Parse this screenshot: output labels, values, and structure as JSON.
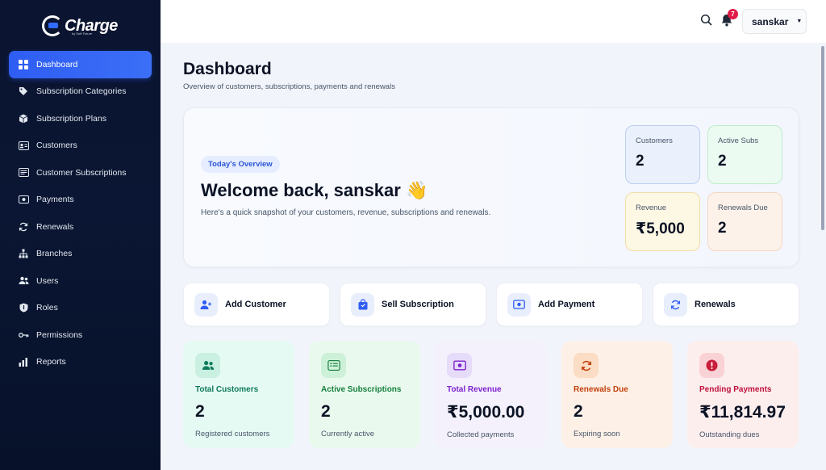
{
  "brand": {
    "name": "Charge",
    "tagline": "by Soft Future"
  },
  "sidebar": {
    "items": [
      {
        "label": "Dashboard",
        "icon": "grid-icon",
        "active": true
      },
      {
        "label": "Subscription Categories",
        "icon": "tag-icon"
      },
      {
        "label": "Subscription Plans",
        "icon": "box-icon"
      },
      {
        "label": "Customers",
        "icon": "id-card-icon"
      },
      {
        "label": "Customer Subscriptions",
        "icon": "list-card-icon"
      },
      {
        "label": "Payments",
        "icon": "money-icon"
      },
      {
        "label": "Renewals",
        "icon": "refresh-icon"
      },
      {
        "label": "Branches",
        "icon": "hierarchy-icon"
      },
      {
        "label": "Users",
        "icon": "users-icon"
      },
      {
        "label": "Roles",
        "icon": "shield-icon"
      },
      {
        "label": "Permissions",
        "icon": "key-icon"
      },
      {
        "label": "Reports",
        "icon": "bar-chart-icon"
      }
    ]
  },
  "topbar": {
    "notifications": "7",
    "user": "sanskar"
  },
  "page": {
    "title": "Dashboard",
    "subtitle": "Overview of customers, subscriptions, payments and renewals"
  },
  "hero": {
    "pill": "Today's Overview",
    "title": "Welcome back, sanskar 👋",
    "description": "Here's a quick snapshot of your customers, revenue, subscriptions and renewals.",
    "stats": [
      {
        "label": "Customers",
        "value": "2",
        "tone": "blue"
      },
      {
        "label": "Active Subs",
        "value": "2",
        "tone": "green"
      },
      {
        "label": "Revenue",
        "value": "₹5,000",
        "tone": "yellow"
      },
      {
        "label": "Renewals Due",
        "value": "2",
        "tone": "peach"
      }
    ]
  },
  "actions": [
    {
      "label": "Add Customer",
      "icon": "add-user-icon"
    },
    {
      "label": "Sell Subscription",
      "icon": "shopping-bag-icon"
    },
    {
      "label": "Add Payment",
      "icon": "money-icon"
    },
    {
      "label": "Renewals",
      "icon": "refresh-icon"
    }
  ],
  "stats": [
    {
      "title": "Total Customers",
      "value": "2",
      "sub": "Registered customers",
      "icon": "users-icon",
      "accent": "#0f7a5a"
    },
    {
      "title": "Active Subscriptions",
      "value": "2",
      "sub": "Currently active",
      "icon": "list-card-icon",
      "accent": "#15803d"
    },
    {
      "title": "Total Revenue",
      "value": "₹5,000.00",
      "sub": "Collected payments",
      "icon": "money-icon",
      "accent": "#7e22ce"
    },
    {
      "title": "Renewals Due",
      "value": "2",
      "sub": "Expiring soon",
      "icon": "refresh-icon",
      "accent": "#c2410c"
    },
    {
      "title": "Pending Payments",
      "value": "₹11,814.97",
      "sub": "Outstanding dues",
      "icon": "alert-icon",
      "accent": "#be123c"
    }
  ],
  "colors": {
    "primary": "#2f5df3",
    "sidebar_bg": "#0b1430",
    "danger": "#e11d48"
  }
}
